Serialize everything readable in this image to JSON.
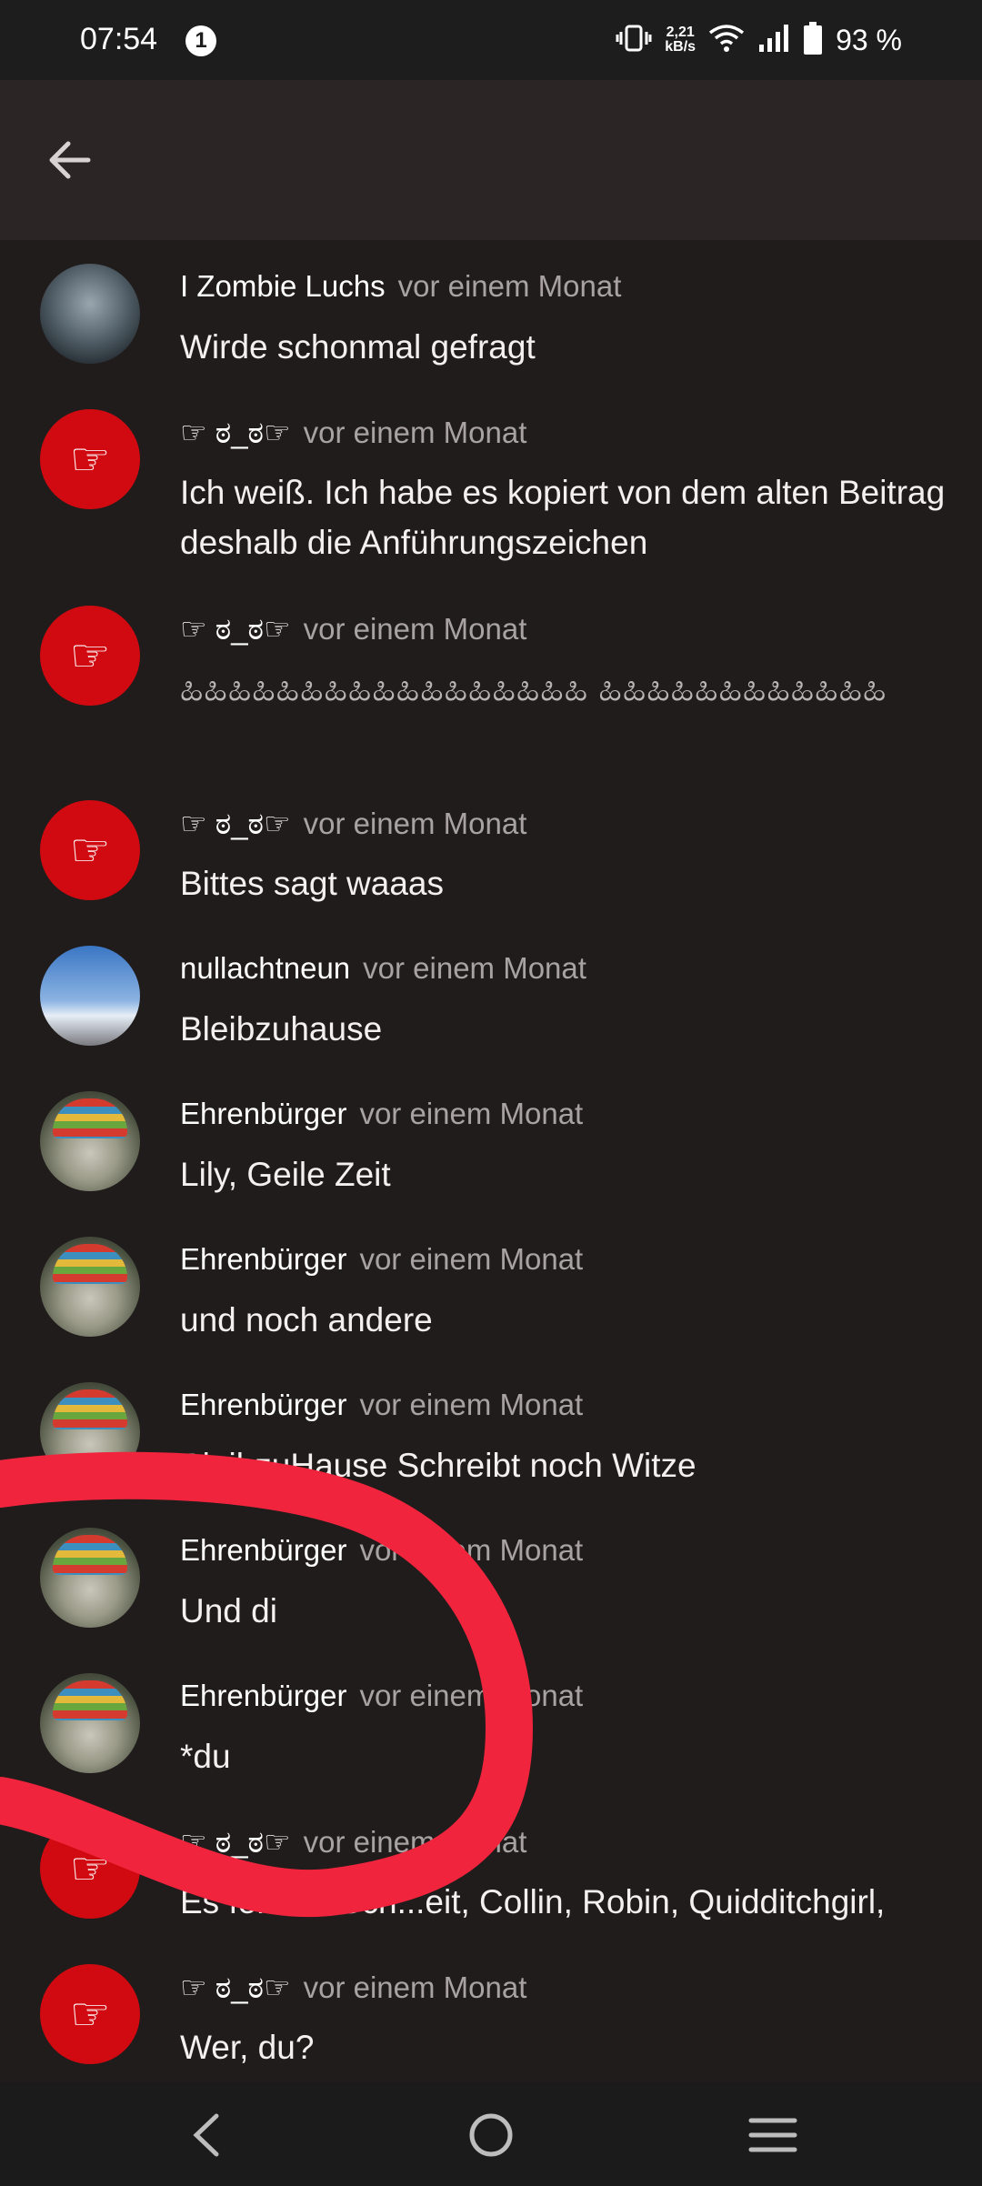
{
  "status_bar": {
    "time": "07:54",
    "notification_count": "1",
    "net_speed_value": "2,21",
    "net_speed_unit": "kB/s",
    "battery": "93 %"
  },
  "comments": [
    {
      "author": "I Zombie Luchs",
      "time": "vor einem Monat",
      "text": "Wirde schonmal gefragt",
      "avatar": "lynx-photo"
    },
    {
      "author": "☞ ಠ_ಠ☞",
      "time": "vor einem Monat",
      "text": "Ich weiß. Ich habe es kopiert von dem alten Beitrag deshalb die Anführungszeichen",
      "avatar": "pointing-hand"
    },
    {
      "author": "☞ ಠ_ಠ☞",
      "time": "vor einem Monat",
      "text": "ಹಿಹಿಹಿಹಿಹಿಹಿಹಿಹಿಹಿಹಿಹಿಹಿಹಿಹಿಹಿಹಿಹಿ ಹಿಹಿಹಿಹಿಹಿಹಿಹಿಹಿಹಿಹಿಹಿಹಿ",
      "avatar": "pointing-hand"
    },
    {
      "author": "☞ ಠ_ಠ☞",
      "time": "vor einem Monat",
      "text": "Bittes sagt waaas",
      "avatar": "pointing-hand"
    },
    {
      "author": "nullachtneun",
      "time": "vor einem Monat",
      "text": "Bleibzuhause",
      "avatar": "city-photo"
    },
    {
      "author": "Ehrenbürger",
      "time": "vor einem Monat",
      "text": "Lily, Geile Zeit",
      "avatar": "hamster-photo"
    },
    {
      "author": "Ehrenbürger",
      "time": "vor einem Monat",
      "text": "und noch andere",
      "avatar": "hamster-photo"
    },
    {
      "author": "Ehrenbürger",
      "time": "vor einem Monat",
      "text": "BleibzuHause Schreibt noch Witze",
      "avatar": "hamster-photo"
    },
    {
      "author": "Ehrenbürger",
      "time": "vor einem Monat",
      "text": "Und di",
      "avatar": "hamster-photo"
    },
    {
      "author": "Ehrenbürger",
      "time": "vor einem Monat",
      "text": "*du",
      "avatar": "hamster-photo"
    },
    {
      "author": "☞ ಠ_ಠ☞",
      "time": "vor einem Monat",
      "text": "Es fehlen: Sch...eit, Collin, Robin, Quidditchgirl,",
      "avatar": "pointing-hand"
    },
    {
      "author": "☞ ಠ_ಠ☞",
      "time": "vor einem Monat",
      "text": "Wer, du?",
      "avatar": "pointing-hand"
    }
  ],
  "colors": {
    "accent_red": "#d00a10",
    "scribble_red": "#f0243c",
    "background": "#211c1c"
  }
}
